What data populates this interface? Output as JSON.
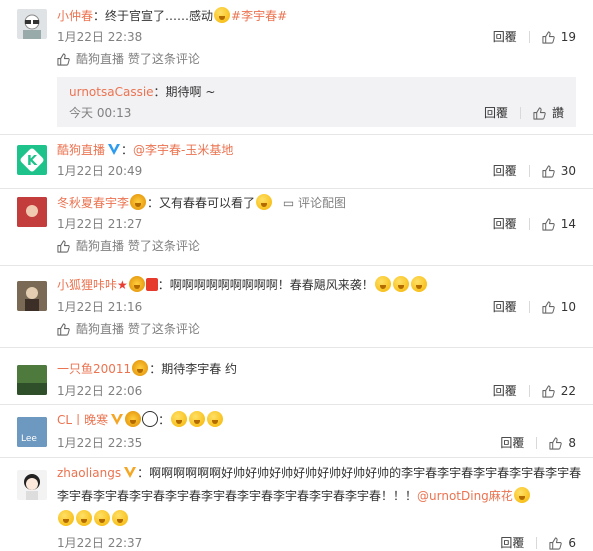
{
  "comments": [
    {
      "nick": "小仲春",
      "colon": "：",
      "text": "终于官宣了……感动",
      "hashtag": "#李宇春#",
      "time": "1月22日 22:38",
      "reply": "回覆",
      "likes": "19",
      "liked_by": "酷狗直播 赞了这条评论",
      "sub": {
        "nick": "urnotsaCassie",
        "text": "：期待啊 ~",
        "time": "今天 00:13",
        "reply": "回覆",
        "likes": "讚"
      }
    },
    {
      "nick": "酷狗直播",
      "text_prefix": "：",
      "mention": "@李宇春-玉米基地",
      "time": "1月22日 20:49",
      "reply": "回覆",
      "likes": "30"
    },
    {
      "nick": "冬秋夏春宇李",
      "text": "：又有春春可以看了",
      "pic_link": "评论配图",
      "time": "1月22日 21:27",
      "reply": "回覆",
      "likes": "14",
      "liked_by": "酷狗直播 赞了这条评论"
    },
    {
      "nick": "小狐狸咔咔",
      "text": "：啊啊啊啊啊啊啊啊啊！春春飓风来袭！",
      "time": "1月22日 21:16",
      "reply": "回覆",
      "likes": "10",
      "liked_by": "酷狗直播 赞了这条评论"
    },
    {
      "nick": "一只鱼20011",
      "text": "：期待李宇春 约",
      "time": "1月22日 22:06",
      "reply": "回覆",
      "likes": "22"
    },
    {
      "nick": "CL丨晚寒",
      "text": "：",
      "time": "1月22日 22:35",
      "reply": "回覆",
      "likes": "8"
    },
    {
      "nick": "zhaoliangs",
      "text_line1": "：啊啊啊啊啊啊好帅好帅好帅好帅好帅好帅好帅的李宇春李宇春李宇春李宇春李宇春",
      "text_line2": "李宇春李宇春李宇春李宇春李宇春李宇春李宇春李宇春李宇春！！！",
      "mention": "@urnotDing麻花",
      "time": "1月22日 22:37",
      "reply": "回覆",
      "likes": "6"
    }
  ],
  "colors": {
    "link": "#eb7350",
    "gray": "#808080"
  }
}
